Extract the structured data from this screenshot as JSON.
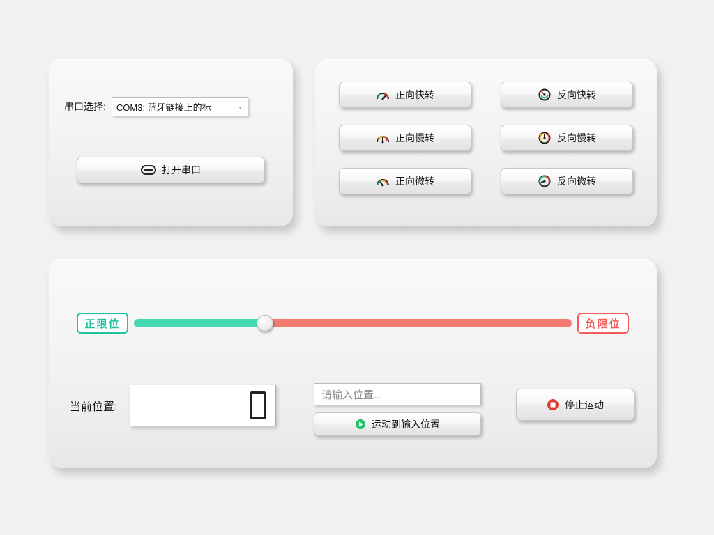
{
  "serial": {
    "label": "串口选择:",
    "selected": "COM3: 蓝牙链接上的标",
    "open_button": "打开串口"
  },
  "motion_buttons": {
    "fwd_fast": "正向快转",
    "rev_fast": "反向快转",
    "fwd_slow": "正向慢转",
    "rev_slow": "反向慢转",
    "fwd_micro": "正向微转",
    "rev_micro": "反向微转"
  },
  "limits": {
    "positive": "正限位",
    "negative": "负限位"
  },
  "slider": {
    "value_percent": 30
  },
  "position": {
    "label": "当前位置:",
    "value": "0",
    "input_placeholder": "请输入位置...",
    "goto_button": "运动到输入位置",
    "stop_button": "停止运动"
  }
}
